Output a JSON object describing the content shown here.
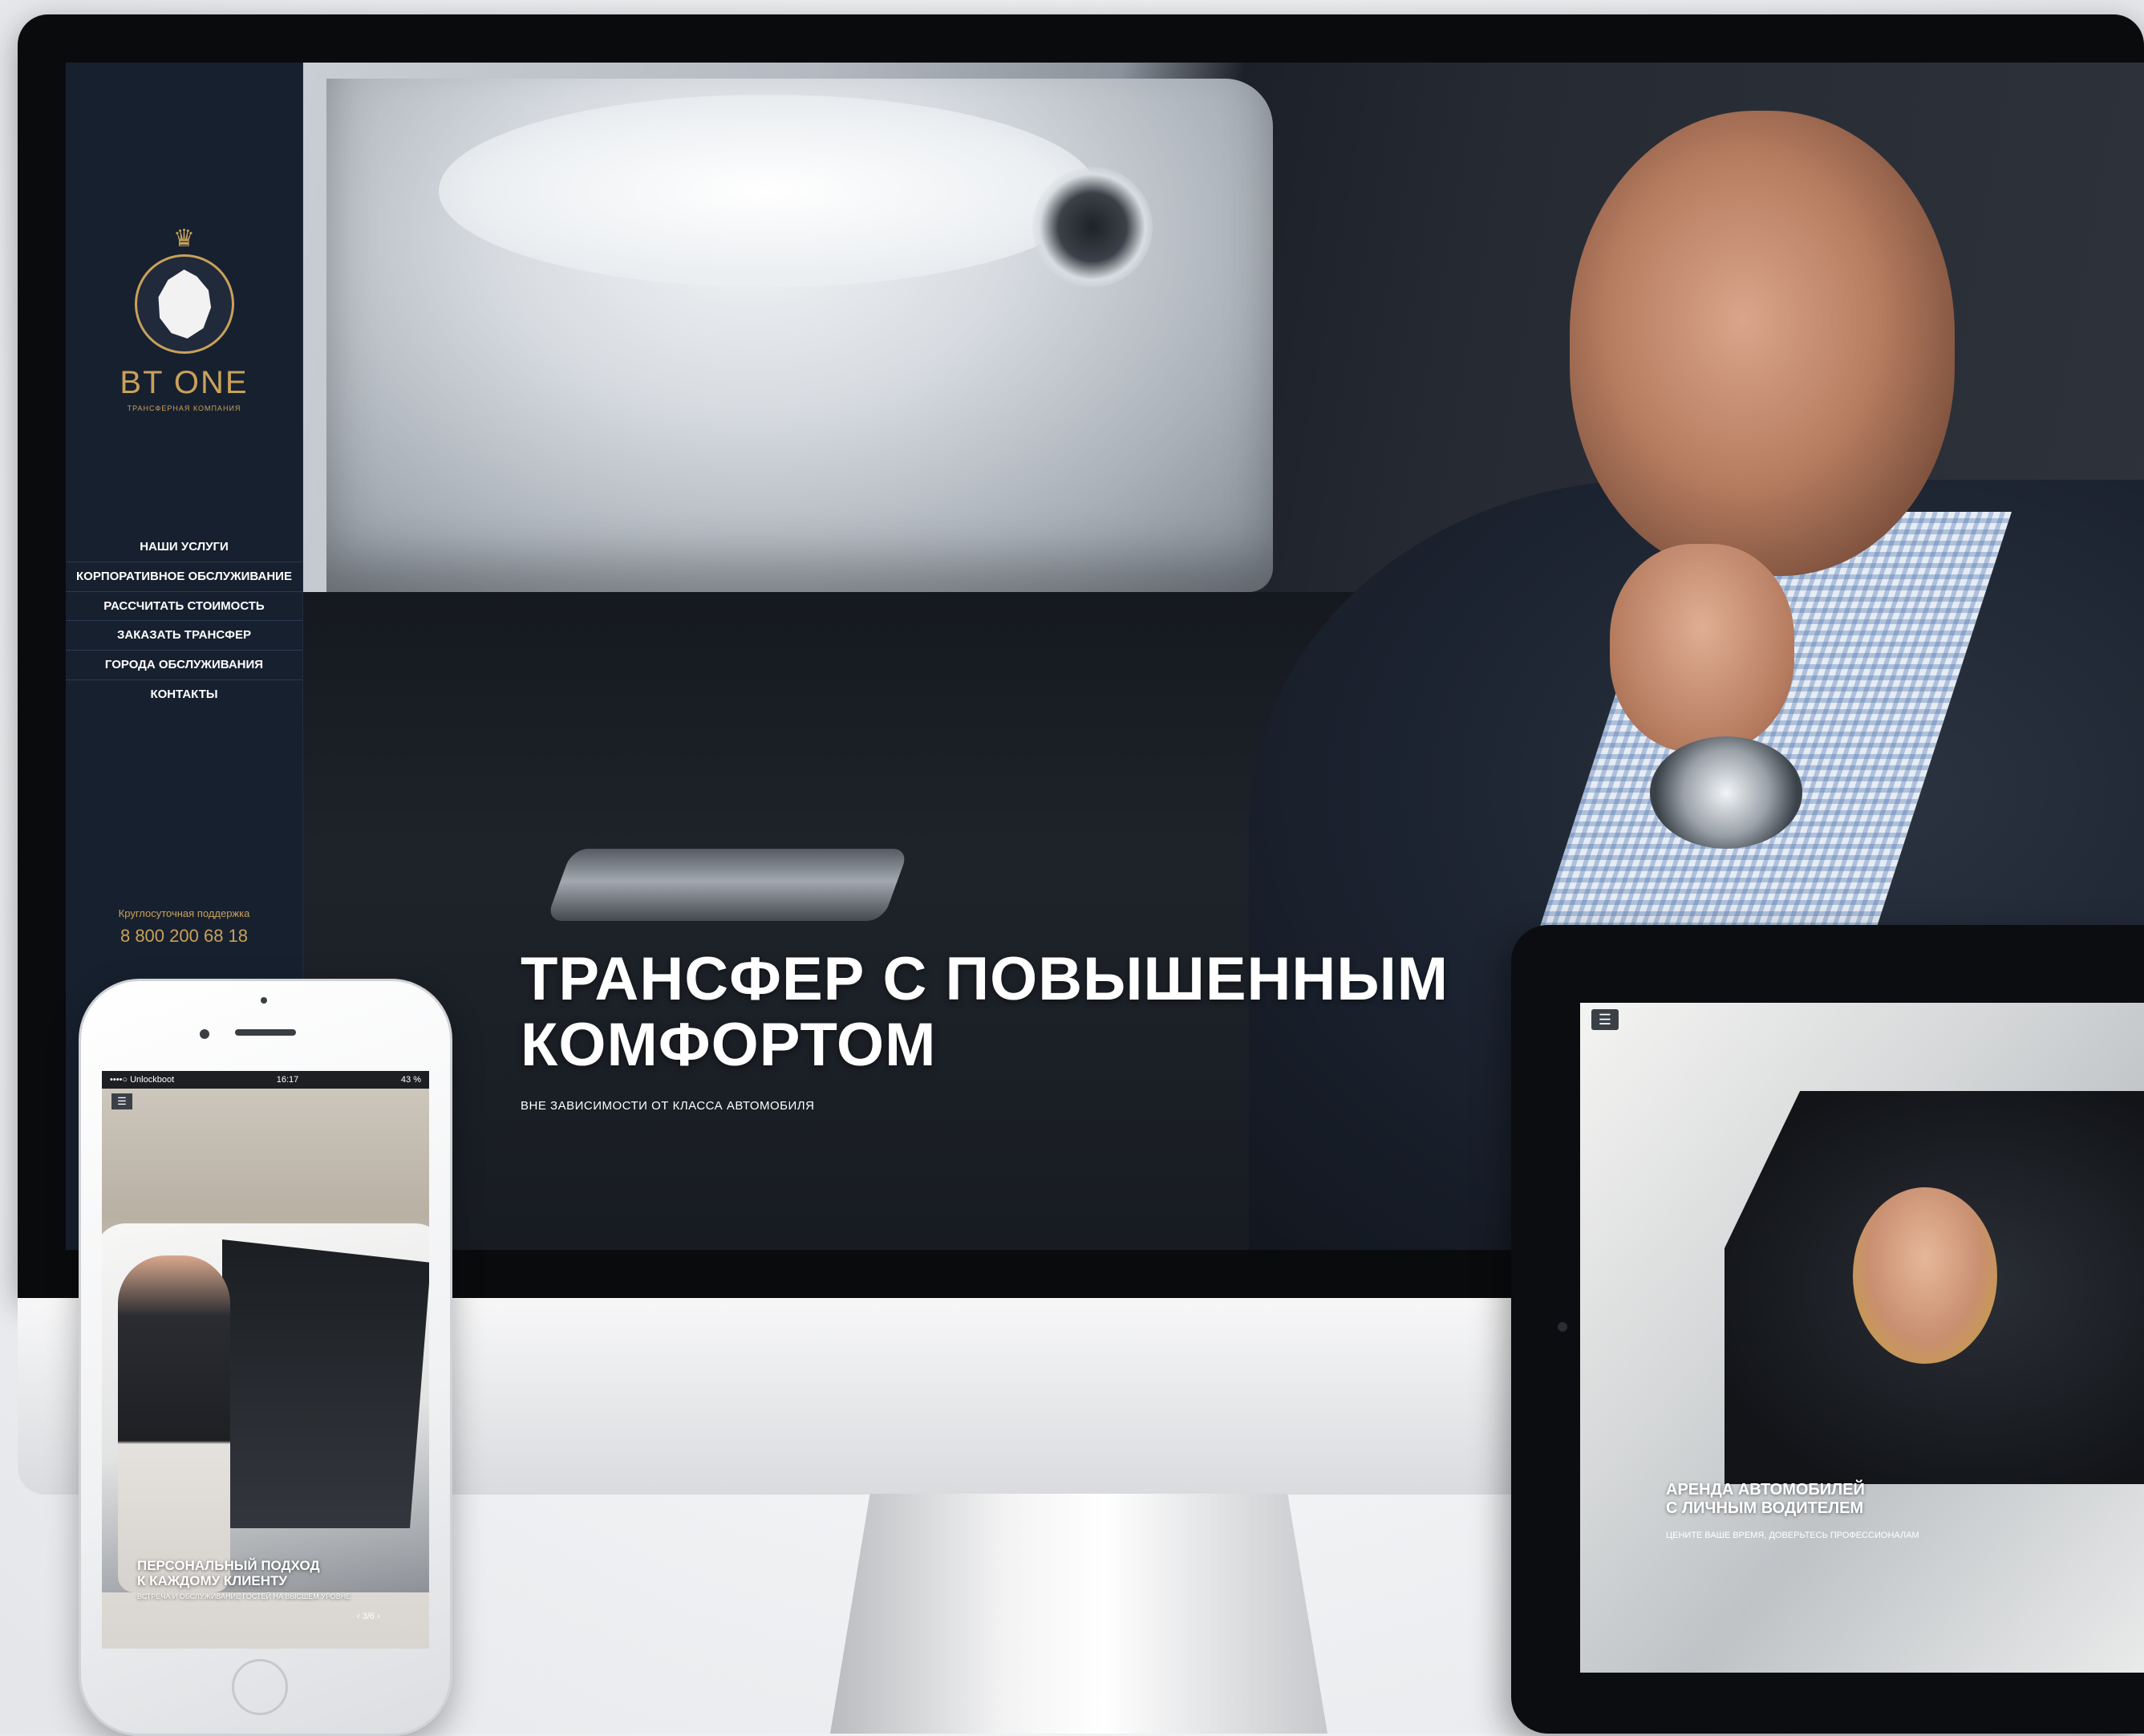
{
  "desktop": {
    "logo": {
      "name": "BT ONE",
      "tagline": "ТРАНСФЕРНАЯ КОМПАНИЯ"
    },
    "nav": [
      "НАШИ УСЛУГИ",
      "КОРПОРАТИВНОЕ ОБСЛУЖИВАНИЕ",
      "РАССЧИТАТЬ СТОИМОСТЬ",
      "ЗАКАЗАТЬ ТРАНСФЕР",
      "ГОРОДА ОБСЛУЖИВАНИЯ",
      "КОНТАКТЫ"
    ],
    "support_label": "Круглосуточная поддержка",
    "support_phone": "8 800 200 68 18",
    "hero_title_line1": "ТРАНСФЕР С ПОВЫШЕННЫМ",
    "hero_title_line2": "КОМФОРТОМ",
    "hero_subtitle": "ВНЕ ЗАВИСИМОСТИ ОТ КЛАССА АВТОМОБИЛЯ"
  },
  "tablet": {
    "menu_icon": "☰",
    "title_line1": "АРЕНДА АВТОМОБИЛЕЙ",
    "title_line2": "С ЛИЧНЫМ ВОДИТЕЛЕМ",
    "subtitle": "ЦЕНИТЕ ВАШЕ ВРЕМЯ, ДОВЕРЬТЕСЬ ПРОФЕССИОНАЛАМ"
  },
  "phone": {
    "status_carrier": "••••○ Unlockboot",
    "status_time": "16:17",
    "status_battery": "43 %",
    "menu_icon": "☰",
    "title_line1": "ПЕРСОНАЛЬНЫЙ ПОДХОД",
    "title_line2": "К КАЖДОМУ КЛИЕНТУ",
    "subtitle": "ВСТРЕЧА И ОБСЛУЖИВАНИЕ ГОСТЕЙ НА ВЫСШЕМ УРОВНЕ",
    "pager": "‹ 3/6 ›"
  },
  "colors": {
    "sidebar_bg": "#17202e",
    "gold_accent": "#c9a15b",
    "hero_text": "#ffffff"
  },
  "icons": [
    "crown-icon",
    "lion-logo-icon",
    "hamburger-menu-icon"
  ]
}
